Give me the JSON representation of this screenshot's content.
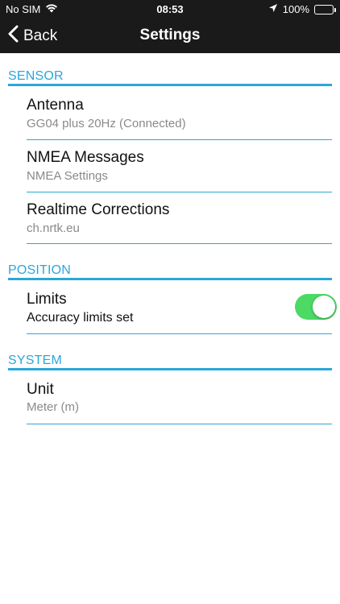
{
  "status_bar": {
    "carrier": "No SIM",
    "time": "08:53",
    "battery": "100%",
    "battery_level": 1.0
  },
  "nav": {
    "back_label": "Back",
    "title": "Settings"
  },
  "sections": {
    "sensor": {
      "header": "SENSOR",
      "items": [
        {
          "title": "Antenna",
          "subtitle": "GG04 plus 20Hz (Connected)"
        },
        {
          "title": "NMEA Messages",
          "subtitle": "NMEA Settings"
        },
        {
          "title": "Realtime Corrections",
          "subtitle": "ch.nrtk.eu"
        }
      ]
    },
    "position": {
      "header": "POSITION",
      "items": [
        {
          "title": "Limits",
          "subtitle": "Accuracy limits set",
          "toggle_on": true
        }
      ]
    },
    "system": {
      "header": "SYSTEM",
      "items": [
        {
          "title": "Unit",
          "subtitle": "Meter (m)"
        }
      ]
    }
  },
  "colors": {
    "accent": "#2aa7d9",
    "toggle_on": "#4cd964",
    "nav_bar": "#1a1a1a"
  }
}
